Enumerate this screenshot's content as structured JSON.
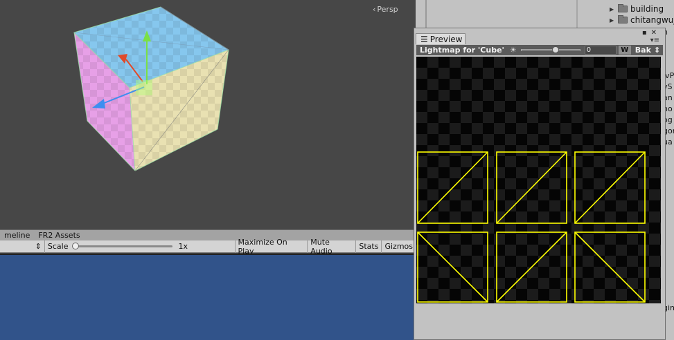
{
  "scene": {
    "projection_label": "Persp",
    "cube_faces": {
      "top": "#86c7ee",
      "left": "#e7a0e7",
      "right": "#e9e1b2"
    }
  },
  "tabs": [
    "meline",
    "FR2 Assets"
  ],
  "game_toolbar": {
    "scale_label": "Scale",
    "scale_value": "1x",
    "scale_level": 0.0,
    "maximize_on_play": "Maximize On Play",
    "mute_audio": "Mute Audio",
    "stats": "Stats",
    "gizmos": "Gizmos"
  },
  "hierarchy": {
    "items": [
      "building",
      "chitangwuj"
    ],
    "clipped_lines": [
      "n",
      "lvP",
      "vS",
      "an",
      "ho",
      "og",
      "gon",
      "ua",
      "i",
      "gin"
    ]
  },
  "preview": {
    "tab_label": "Preview",
    "header_title": "Lightmap for 'Cube'",
    "exposure_value": "0",
    "exposure_level": 0.6,
    "w_button": "W",
    "bake_label": "Bak",
    "uv_color": "#ffff00",
    "uv_islands": 6
  },
  "colors": {
    "game_bg": "#31538a",
    "scene_bg": "#474747"
  }
}
